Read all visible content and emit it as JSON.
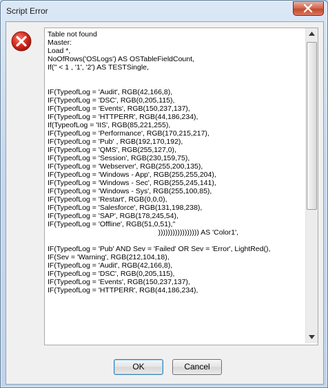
{
  "window": {
    "title": "Script Error"
  },
  "icons": {
    "error": "error-icon",
    "close": "close-icon"
  },
  "message": {
    "lines": [
      "Table not found",
      "Master:",
      "Load *,",
      "NoOfRows('OSLogs') AS OSTableFieldCount,",
      "If('' < 1 , '1', '2') AS TESTSingle,",
      "",
      "",
      "IF(TypeofLog = 'Audit', RGB(42,166,8),",
      "IF(TypeofLog = 'DSC', RGB(0,205,115),",
      "IF(TypeofLog = 'Events', RGB(150,237,137),",
      "IF(TypeofLog = 'HTTPERR', RGB(44,186,234),",
      "If(TypeofLog = 'IIS', RGB(85,221,255),",
      "IF(TypeofLog = 'Performance', RGB(170,215,217),",
      "IF(TypeofLog = 'Pub' , RGB(192,170,192),",
      "IF(TypeofLog = 'QMS', RGB(255,127,0),",
      "IF(TypeofLog = 'Session', RGB(230,159,75),",
      "IF(TypeofLog = 'Webserver', RGB(255,200,135),",
      "IF(TypeofLog = 'Windows - App', RGB(255,255,204),",
      "IF(TypeofLog = 'Windows - Sec', RGB(255,245,141),",
      "IF(TypeofLog = 'Windows - Sys', RGB(255,100,85),",
      "IF(TypeofLog = 'Restart', RGB(0,0,0),",
      "IF(TypeofLog = 'Salesforce', RGB(131,198,238),",
      "IF(TypeofLog = 'SAP', RGB(178,245,54),",
      "IF(TypeofLog = 'Offline', RGB(51,0,51),''",
      "                                                       ))))))))))))))))) AS 'Color1',",
      "",
      "IF(TypeofLog = 'Pub' AND Sev = 'Failed' OR Sev = 'Error', LightRed(),",
      "IF(Sev = 'Warning', RGB(212,104,18),",
      "IF(TypeofLog = 'Audit', RGB(42,166,8),",
      "IF(TypeofLog = 'DSC', RGB(0,205,115),",
      "IF(TypeofLog = 'Events', RGB(150,237,137),",
      "IF(TypeofLog = 'HTTPERR', RGB(44,186,234),"
    ]
  },
  "buttons": {
    "ok": "OK",
    "cancel": "Cancel"
  }
}
